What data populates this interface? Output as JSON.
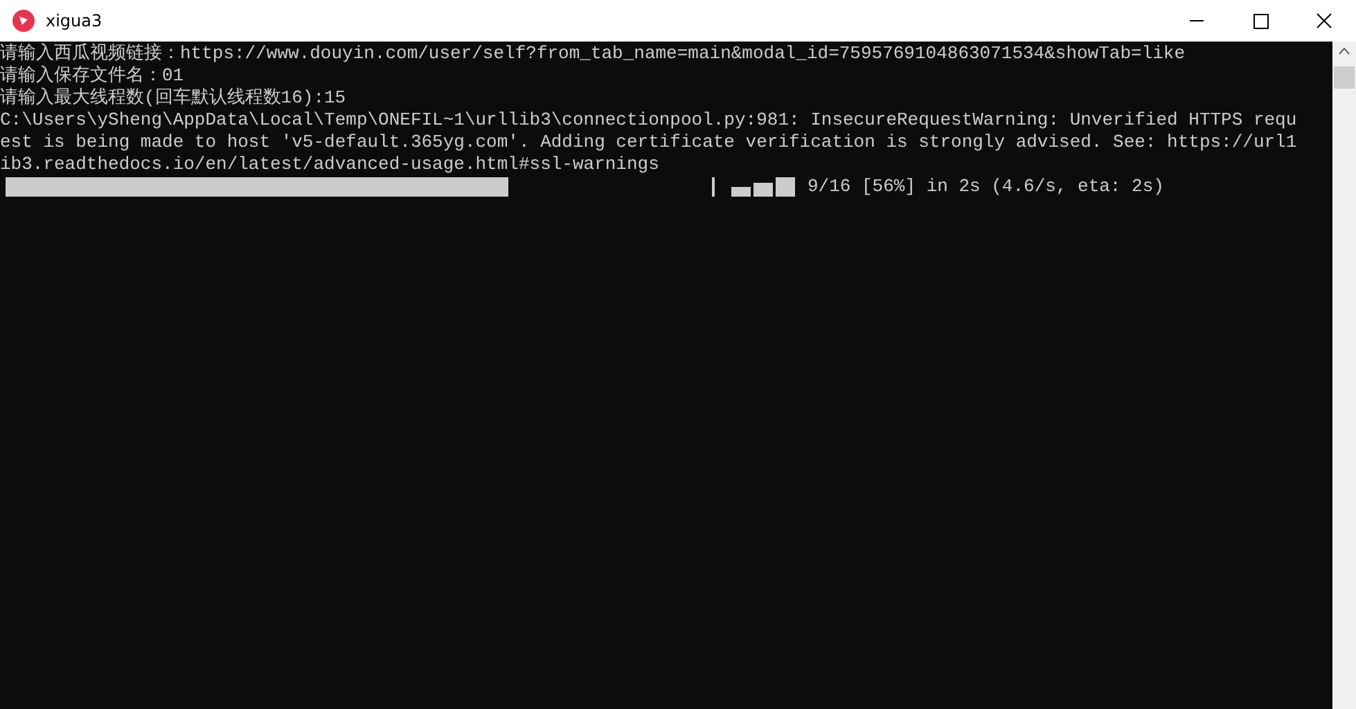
{
  "window": {
    "title": "xigua3"
  },
  "console": {
    "lines": [
      "请输入西瓜视频链接：https://www.douyin.com/user/self?from_tab_name=main&modal_id=7595769104863071534&showTab=like",
      "请输入保存文件名：01",
      "请输入最大线程数(回车默认线程数16):15",
      "C:\\Users\\ySheng\\AppData\\Local\\Temp\\ONEFIL~1\\urllib3\\connectionpool.py:981: InsecureRequestWarning: Unverified HTTPS requ",
      "est is being made to host 'v5-default.365yg.com'. Adding certificate verification is strongly advised. See: https://url1",
      "ib3.readthedocs.io/en/latest/advanced-usage.html#ssl-warnings"
    ],
    "progress": {
      "level": 0.71,
      "status": "9/16 [56%] in 2s (4.6/s, eta: 2s)"
    }
  }
}
